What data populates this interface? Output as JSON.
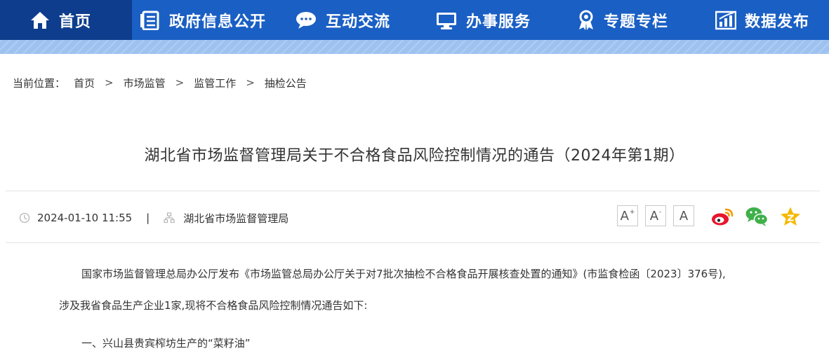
{
  "nav": {
    "items": [
      {
        "label": "首页",
        "icon": "home-icon"
      },
      {
        "label": "政府信息公开",
        "icon": "document-list-icon"
      },
      {
        "label": "互动交流",
        "icon": "chat-bubble-icon"
      },
      {
        "label": "办事服务",
        "icon": "monitor-icon"
      },
      {
        "label": "专题专栏",
        "icon": "award-ribbon-icon"
      },
      {
        "label": "数据发布",
        "icon": "bar-chart-icon"
      }
    ]
  },
  "breadcrumb": {
    "prefix": "当前位置：",
    "items": [
      "首页",
      "市场监管",
      "监管工作",
      "抽检公告"
    ],
    "separator": ">"
  },
  "article": {
    "title": "湖北省市场监督管理局关于不合格食品风险控制情况的通告（2024年第1期）",
    "date": "2024-01-10 11:55",
    "divider": "|",
    "source": "湖北省市场监督管理局",
    "font_sizes": [
      {
        "label": "A",
        "variant": "larger"
      },
      {
        "label": "A",
        "variant": "smaller"
      },
      {
        "label": "A",
        "variant": "default"
      }
    ],
    "share": [
      "weibo-icon",
      "wechat-icon",
      "qzone-star-icon"
    ],
    "paragraphs": [
      "国家市场监督管理总局办公厅发布《市场监管总局办公厅关于对7批次抽检不合格食品开展核查处置的通知》(市监食检函〔2023〕376号),",
      "涉及我省食品生产企业1家,现将不合格食品风险控制情况通告如下:",
      "一、兴山县贵宾榨坊生产的“菜籽油”"
    ]
  },
  "colors": {
    "nav_bg": "#1a5fc4",
    "nav_active_bg": "#0d3d8c",
    "nav_band": "#9ec2f0",
    "weibo": "#e6162d",
    "wechat": "#3fb04a",
    "star": "#f5b800"
  }
}
